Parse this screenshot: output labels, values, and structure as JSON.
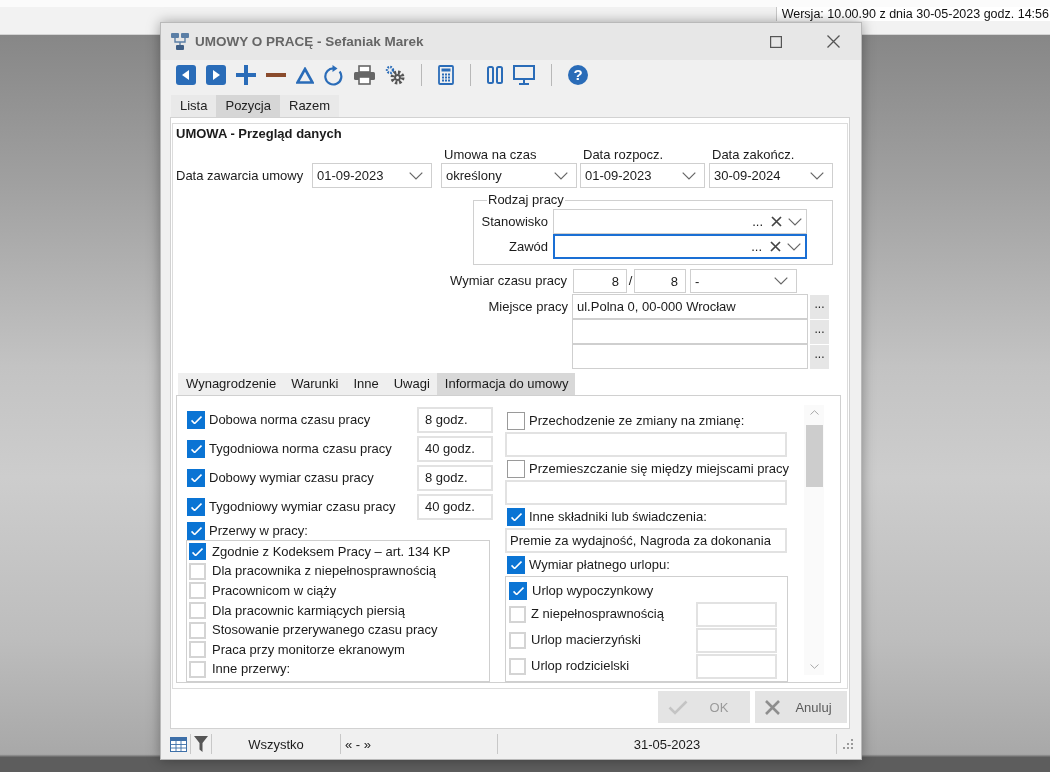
{
  "top_bar": {
    "version": "Wersja: 10.00.90 z dnia 30-05-2023 godz. 14:56"
  },
  "window": {
    "title": "UMOWY O PRACĘ - Sefaniak Marek"
  },
  "toolbar": {
    "help": "?"
  },
  "tabs": [
    {
      "label": "Lista",
      "selected": false
    },
    {
      "label": "Pozycja",
      "selected": true
    },
    {
      "label": "Razem",
      "selected": false
    }
  ],
  "form": {
    "title": "UMOWA - Przegląd danych",
    "contract_date": {
      "label": "Data zawarcia umowy",
      "value": "01-09-2023"
    },
    "contract_period": {
      "label": "Umowa na czas",
      "value": "określony"
    },
    "start_date": {
      "label": "Data rozpocz.",
      "value": "01-09-2023"
    },
    "end_date": {
      "label": "Data zakończ.",
      "value": "30-09-2024"
    },
    "work_type": {
      "legend": "Rodzaj pracy",
      "fields": [
        {
          "label": "Stanowisko",
          "browse": "...",
          "focused": false
        },
        {
          "label": "Zawód",
          "browse": "...",
          "focused": true
        }
      ]
    },
    "working_time": {
      "label": "Wymiar czasu pracy",
      "numerator": "8",
      "separator": "/",
      "denominator": "8",
      "unit": "-"
    },
    "workplace": {
      "label": "Miejsce pracy",
      "lines": [
        {
          "value": "ul.Polna 0, 00-000 Wrocław",
          "browse": "..."
        },
        {
          "browse": "..."
        },
        {
          "browse": "..."
        }
      ]
    }
  },
  "subtabs": [
    {
      "label": "Wynagrodzenie",
      "selected": false
    },
    {
      "label": "Warunki",
      "selected": false
    },
    {
      "label": "Inne",
      "selected": false
    },
    {
      "label": "Uwagi",
      "selected": false
    },
    {
      "label": "Informacja do umowy",
      "selected": true
    }
  ],
  "info": {
    "left": [
      {
        "kind": "check_value",
        "label": "Dobowa norma czasu pracy",
        "checked": true,
        "value": "8 godz."
      },
      {
        "kind": "check_value",
        "label": "Tygodniowa norma czasu pracy",
        "checked": true,
        "value": "40 godz."
      },
      {
        "kind": "check_value",
        "label": "Dobowy wymiar czasu pracy",
        "checked": true,
        "value": "8 godz."
      },
      {
        "kind": "check_value",
        "label": "Tygodniowy wymiar czasu pracy",
        "checked": true,
        "value": "40 godz."
      },
      {
        "kind": "check_list",
        "label": "Przerwy w pracy:",
        "checked": true,
        "items": [
          {
            "kind": "plain",
            "label": "Zgodnie z Kodeksem Pracy – art. 134 KP",
            "checked": true
          },
          {
            "kind": "plain",
            "label": "Dla pracownika z niepełnosprawnością",
            "checked": false
          },
          {
            "kind": "plain",
            "label": "Pracownicom w ciąży",
            "checked": false
          },
          {
            "kind": "plain",
            "label": "Dla pracownic karmiących piersią",
            "checked": false
          },
          {
            "kind": "plain",
            "label": "Stosowanie przerywanego czasu pracy",
            "checked": false
          },
          {
            "kind": "plain",
            "label": "Praca przy monitorze ekranowym",
            "checked": false
          },
          {
            "kind": "plain",
            "label": "Inne przerwy:",
            "checked": false
          }
        ]
      }
    ],
    "right": [
      {
        "kind": "check_field",
        "label": "Przechodzenie ze zmiany na zmianę:",
        "checked": false
      },
      {
        "kind": "check_field",
        "label": "Przemieszczanie się między miejscami pracy",
        "checked": false
      },
      {
        "kind": "check_field",
        "label": "Inne składniki lub świadczenia:",
        "checked": true,
        "value": "Premie za wydajność, Nagroda za dokonania"
      },
      {
        "kind": "check_list",
        "label": "Wymiar płatnego urlopu:",
        "checked": true,
        "items": [
          {
            "kind": "plain",
            "label": "Urlop wypoczynkowy",
            "checked": true
          },
          {
            "kind": "with_field",
            "label": "Z niepełnosprawnością",
            "checked": false
          },
          {
            "kind": "with_field",
            "label": "Urlop macierzyński",
            "checked": false
          },
          {
            "kind": "with_field",
            "label": "Urlop rodzicielski",
            "checked": false
          }
        ]
      }
    ]
  },
  "buttons": [
    {
      "kind": "ok",
      "label": "OK",
      "disabled": true
    },
    {
      "kind": "cancel",
      "label": "Anuluj",
      "disabled": false
    }
  ],
  "status_bar": {
    "filter": "Wszystko",
    "range": "« - »",
    "date": "31-05-2023"
  }
}
